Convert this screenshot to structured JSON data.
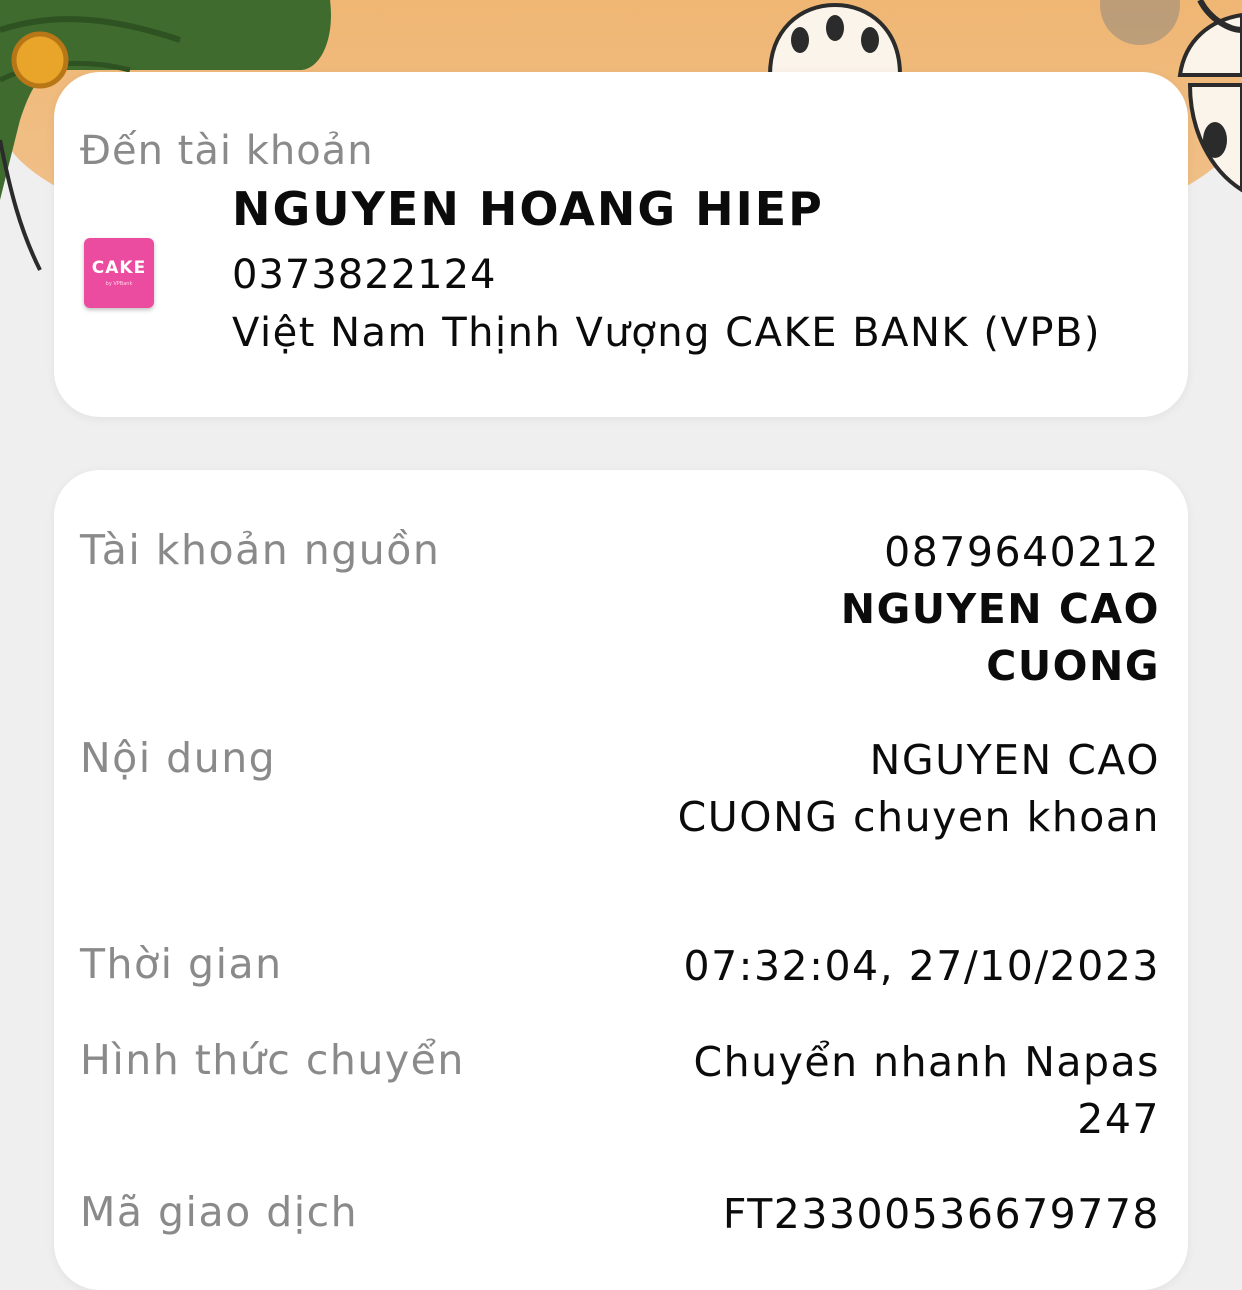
{
  "recipient": {
    "section_label": "Đến tài khoản",
    "name": "NGUYEN HOANG HIEP",
    "account_number": "0373822124",
    "bank": "Việt Nam Thịnh Vượng CAKE BANK (VPB)",
    "logo_text": "CAKE",
    "logo_subtext": "by VPBank",
    "logo_color": "#ec4c9f"
  },
  "details": {
    "source_account": {
      "label": "Tài khoản nguồn",
      "account_number": "0879640212",
      "name_line1": "NGUYEN CAO",
      "name_line2": "CUONG"
    },
    "content": {
      "label": "Nội dung",
      "line1": "NGUYEN CAO",
      "line2": "CUONG chuyen khoan"
    },
    "time": {
      "label": "Thời gian",
      "value": "07:32:04, 27/10/2023"
    },
    "method": {
      "label": "Hình thức chuyển",
      "line1": "Chuyển nhanh Napas",
      "line2": "247"
    },
    "transaction_id": {
      "label": "Mã giao dịch",
      "value": "FT23300536679778"
    }
  },
  "colors": {
    "label_gray": "#8a8a8a",
    "text": "#0b0b0b",
    "background": "#efefef",
    "banner": "#efb46f"
  }
}
